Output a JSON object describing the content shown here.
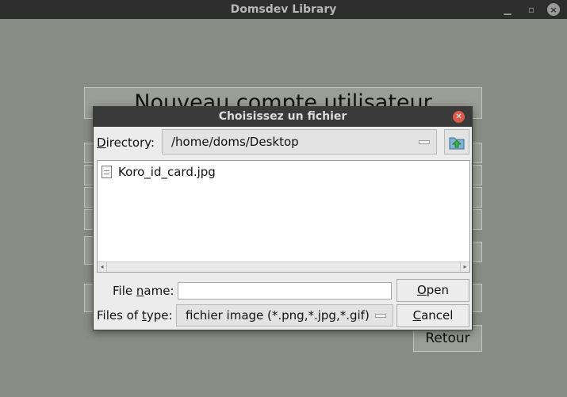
{
  "window": {
    "title": "Domsdev Library",
    "controls": [
      "minimize",
      "maximize",
      "close"
    ]
  },
  "background_app": {
    "header": "Nouveau compte utilisateur",
    "back_button": "Retour"
  },
  "dialog": {
    "title": "Choisissez un fichier",
    "directory_label_prefix": "D",
    "directory_label_rest": "irectory:",
    "directory_value": "/home/doms/Desktop",
    "files": [
      {
        "name": "Koro_id_card.jpg",
        "icon": "document-icon"
      }
    ],
    "file_name_label_a": "File ",
    "file_name_label_u": "n",
    "file_name_label_b": "ame:",
    "file_name_value": "",
    "files_of_type_label_a": "Files of ",
    "files_of_type_label_u": "t",
    "files_of_type_label_b": "ype:",
    "files_of_type_value": "fichier image (*.png,*.jpg,*.gif)",
    "open_u": "O",
    "open_rest": "pen",
    "cancel_u": "C",
    "cancel_rest": "ancel"
  },
  "colors": {
    "background": "#8a8d85",
    "titlebar": "#2d2d2d",
    "dialog_bg": "#ececec",
    "close_red": "#d95b4b"
  }
}
